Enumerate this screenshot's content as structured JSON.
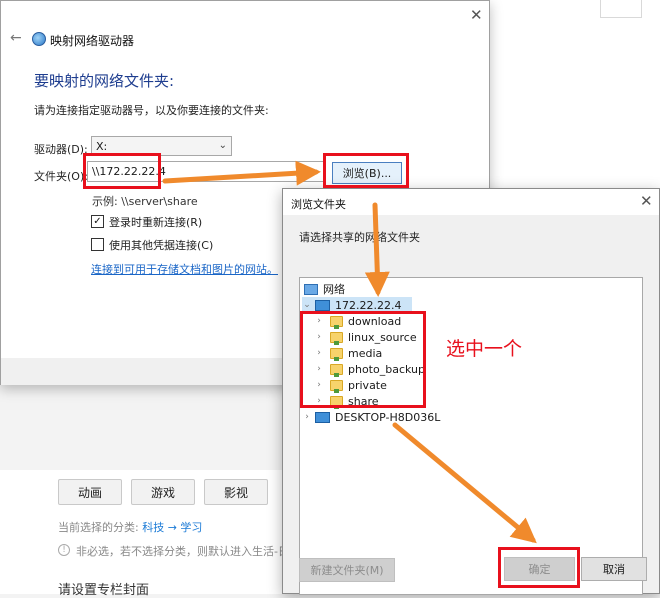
{
  "background_page": {
    "category_buttons": [
      "动画",
      "游戏",
      "影视"
    ],
    "current_category_label": "当前选择的分类:",
    "current_category_path": "科技 → 学习",
    "optional_note": "非必选，若不选择分类，则默认进入生活-日常分区",
    "section_heading": "请设置专栏封面"
  },
  "map_drive_window": {
    "title": "映射网络驱动器",
    "heading": "要映射的网络文件夹:",
    "description": "请为连接指定驱动器号，以及你要连接的文件夹:",
    "drive_label": "驱动器(D):",
    "drive_value": "X:",
    "folder_label": "文件夹(O):",
    "folder_value": "\\\\172.22.22.4",
    "browse_button": "浏览(B)...",
    "example": "示例: \\\\server\\share",
    "reconnect_label": "登录时重新连接(R)",
    "reconnect_checked": true,
    "other_credentials_label": "使用其他凭据连接(C)",
    "other_credentials_checked": false,
    "storage_link": "连接到可用于存储文档和图片的网站。"
  },
  "browse_dialog": {
    "title": "浏览文件夹",
    "prompt": "请选择共享的网络文件夹",
    "tree": {
      "root": "网络",
      "host": "172.22.22.4",
      "shares": [
        "download",
        "linux_source",
        "media",
        "photo_backup",
        "private",
        "share"
      ],
      "other_host": "DESKTOP-H8D036L"
    },
    "new_folder_button": "新建文件夹(M)",
    "ok_button": "确定",
    "cancel_button": "取消"
  },
  "annotation": {
    "text": "选中一个",
    "color": "#e8101c",
    "arrow_color": "#f08a2c"
  }
}
